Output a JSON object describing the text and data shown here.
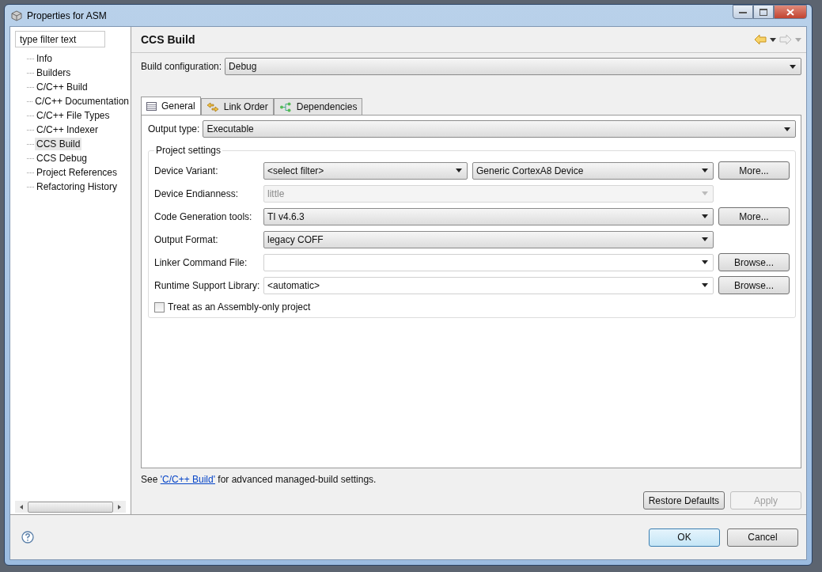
{
  "window": {
    "title": "Properties for ASM"
  },
  "filter": {
    "placeholder": "type filter text"
  },
  "tree": [
    {
      "label": "Info",
      "selected": false
    },
    {
      "label": "Builders",
      "selected": false
    },
    {
      "label": "C/C++ Build",
      "selected": false
    },
    {
      "label": "C/C++ Documentation",
      "selected": false
    },
    {
      "label": "C/C++ File Types",
      "selected": false
    },
    {
      "label": "C/C++ Indexer",
      "selected": false
    },
    {
      "label": "CCS Build",
      "selected": true
    },
    {
      "label": "CCS Debug",
      "selected": false
    },
    {
      "label": "Project References",
      "selected": false
    },
    {
      "label": "Refactoring History",
      "selected": false
    }
  ],
  "page": {
    "title": "CCS Build",
    "back_enabled": true,
    "forward_enabled": false
  },
  "build_configuration": {
    "label": "Build configuration:",
    "value": "Debug"
  },
  "tabs": [
    {
      "label": "General",
      "kind": "table",
      "selected": true
    },
    {
      "label": "Link Order",
      "kind": "order",
      "selected": false
    },
    {
      "label": "Dependencies",
      "kind": "deps",
      "selected": false
    }
  ],
  "output_type": {
    "label": "Output type:",
    "value": "Executable"
  },
  "project_settings": {
    "title": "Project settings",
    "rows": [
      {
        "label": "Device Variant:",
        "kind": "double-combo",
        "value": "<select filter>",
        "value_2": "Generic CortexA8 Device",
        "button": "More...",
        "disabled": false
      },
      {
        "label": "Device Endianness:",
        "kind": "combo",
        "value": "little",
        "disabled": true
      },
      {
        "label": "Code Generation tools:",
        "kind": "combo",
        "value": "TI v4.6.3",
        "button": "More...",
        "disabled": false
      },
      {
        "label": "Output Format:",
        "kind": "combo",
        "value": "legacy COFF",
        "disabled": false
      },
      {
        "label": "Linker Command File:",
        "kind": "editable",
        "button": "Browse...",
        "disabled": false
      },
      {
        "label": "Runtime Support Library:",
        "kind": "editable",
        "value": "<automatic>",
        "button": "Browse...",
        "disabled": false
      }
    ],
    "checkbox": {
      "label": "Treat as an Assembly-only project",
      "checked": false
    }
  },
  "note": {
    "before": "See ",
    "link": "'C/C++ Build'",
    "after": " for advanced managed-build settings."
  },
  "page_buttons": [
    {
      "label": "Restore Defaults",
      "disabled": false
    },
    {
      "label": "Apply",
      "disabled": true
    }
  ],
  "dialog_buttons": [
    {
      "label": "OK",
      "default": true
    },
    {
      "label": "Cancel",
      "default": false
    }
  ]
}
